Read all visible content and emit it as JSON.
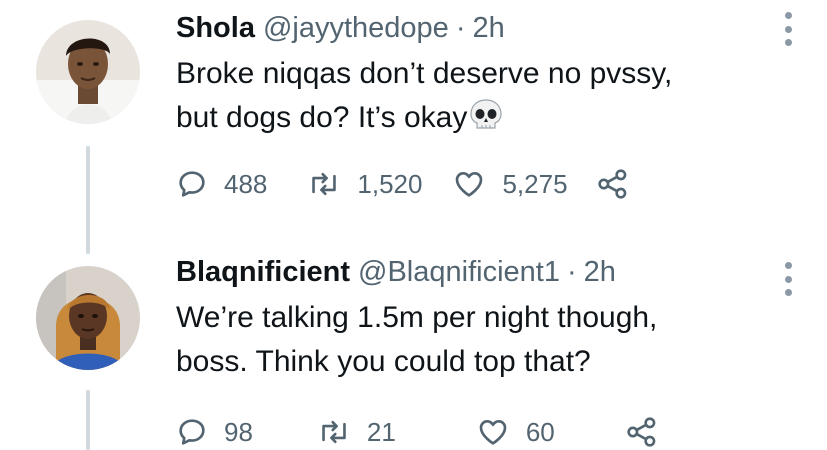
{
  "tweets": [
    {
      "display_name": "Shola",
      "handle": "@jayythedope",
      "separator": "·",
      "time": "2h",
      "text_line1": "Broke niqqas don’t deserve no pvssy,",
      "text_line2": "but dogs do? It’s okay",
      "emoji": "skull-emoji",
      "replies": "488",
      "retweets": "1,520",
      "likes": "5,275"
    },
    {
      "display_name": "Blaqnificient",
      "handle": "@Blaqnificient1",
      "separator": "·",
      "time": "2h",
      "text_line1": "We’re talking 1.5m per night though,",
      "text_line2": "boss. Think you could top that?",
      "replies": "98",
      "retweets": "21",
      "likes": "60"
    }
  ],
  "icons": {
    "reply": "reply-icon",
    "retweet": "retweet-icon",
    "like": "heart-icon",
    "share": "share-icon",
    "more": "more-icon"
  },
  "colors": {
    "text": "#0f1419",
    "secondary": "#536471",
    "thread_line": "#cfd9de"
  }
}
